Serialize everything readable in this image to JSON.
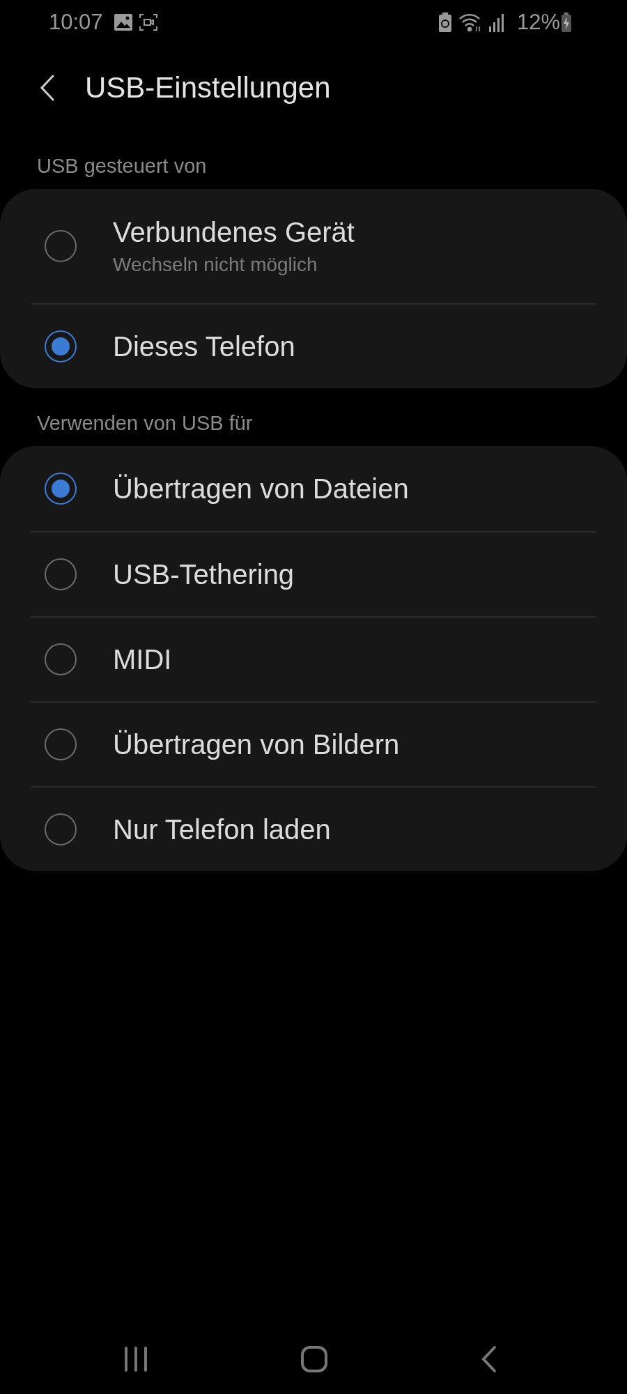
{
  "status_bar": {
    "time": "10:07",
    "battery": "12%"
  },
  "header": {
    "title": "USB-Einstellungen"
  },
  "sections": [
    {
      "label": "USB gesteuert von",
      "options": [
        {
          "label": "Verbundenes Gerät",
          "sublabel": "Wechseln nicht möglich",
          "selected": false
        },
        {
          "label": "Dieses Telefon",
          "selected": true
        }
      ]
    },
    {
      "label": "Verwenden von USB für",
      "options": [
        {
          "label": "Übertragen von Dateien",
          "selected": true
        },
        {
          "label": "USB-Tethering",
          "selected": false
        },
        {
          "label": "MIDI",
          "selected": false
        },
        {
          "label": "Übertragen von Bildern",
          "selected": false
        },
        {
          "label": "Nur Telefon laden",
          "selected": false
        }
      ]
    }
  ]
}
